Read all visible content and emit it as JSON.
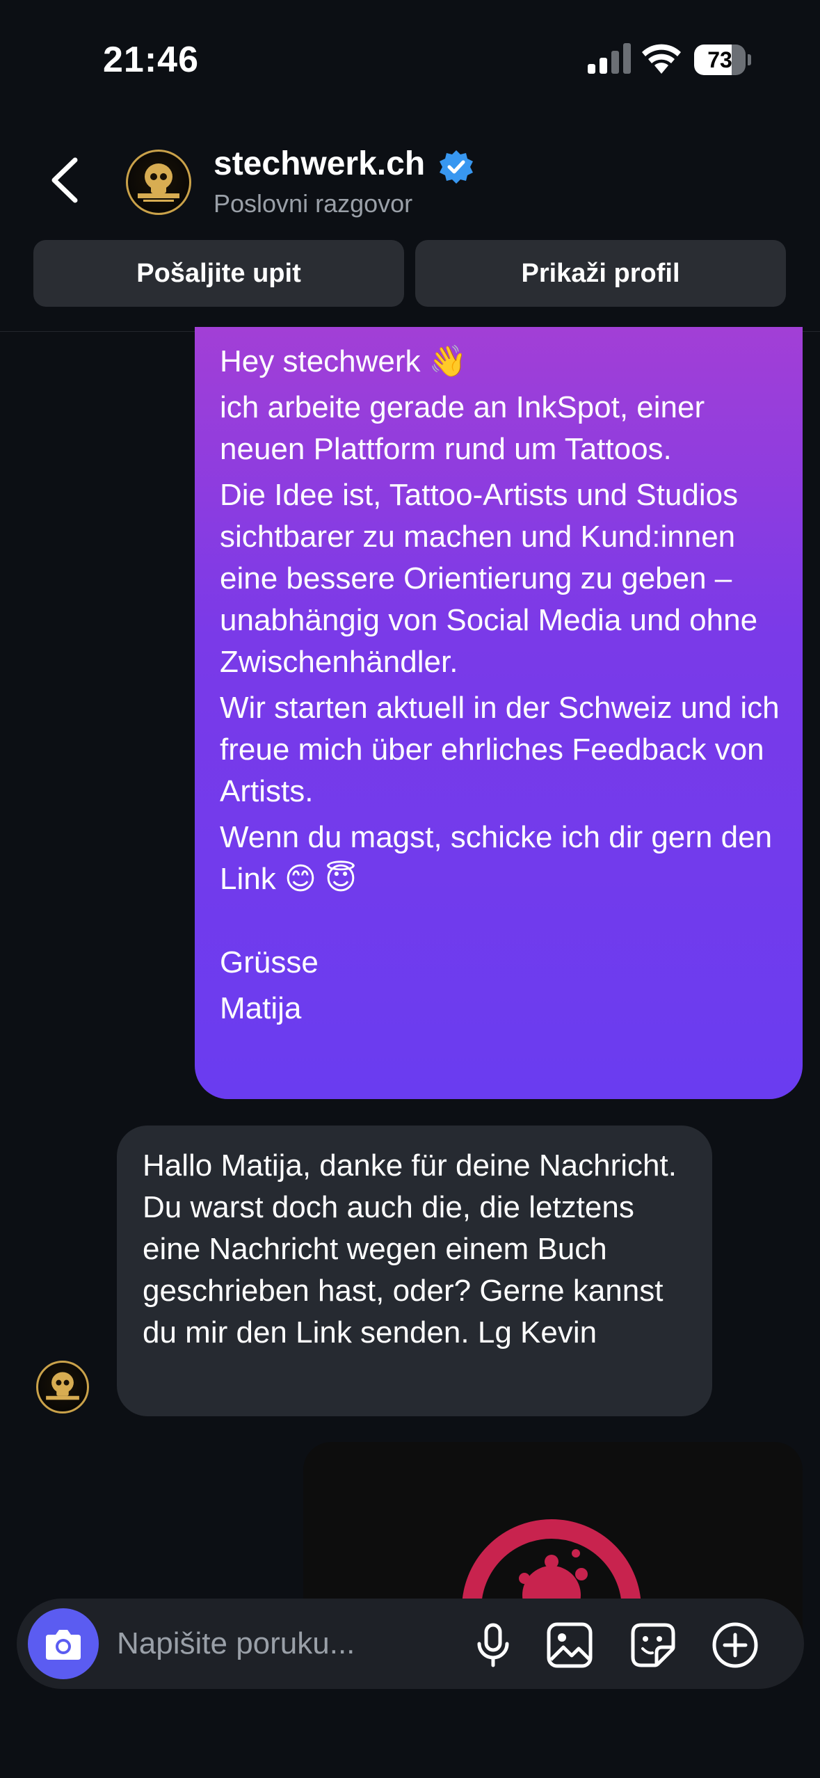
{
  "status_bar": {
    "time": "21:46",
    "battery": "73",
    "battery_level": 0.73
  },
  "header": {
    "name": "stechwerk.ch",
    "subtitle": "Poslovni razgovor",
    "actions": {
      "send_inquiry": "Pošaljite upit",
      "view_profile": "Prikaži profil"
    }
  },
  "messages": {
    "outgoing_1": {
      "paragraphs": [
        "Hey stechwerk 👋",
        "ich arbeite gerade an InkSpot, einer neuen Plattform rund um Tattoos.",
        "Die Idee ist, Tattoo-Artists und Studios sichtbarer zu machen und Kund:innen eine bessere Orientierung zu geben – unabhängig von Social Media und ohne Zwischenhändler.",
        "Wir starten aktuell in der Schweiz und ich freue mich über ehrliches Feedback von Artists.",
        "Wenn du magst, schicke ich dir gern den Link 😊 😇",
        "Grüsse",
        "Matija"
      ]
    },
    "incoming_1": {
      "text": "Hallo Matija, danke für deine Nachricht. Du warst doch auch die, die letztens eine Nachricht wegen einem Buch geschrieben hast, oder? Gerne kannst du mir den Link senden. Lg Kevin"
    }
  },
  "composer": {
    "placeholder": "Napišite poruku..."
  },
  "colors": {
    "background": "#0c0f14",
    "outgoing_top": "#a23fd6",
    "outgoing_bottom": "#6a3cf0",
    "incoming": "#262a31",
    "camera": "#5b5cf1",
    "verified": "#3897f0",
    "inkspot_logo": "#c8234e"
  },
  "icons": [
    "back-chevron-icon",
    "verified-badge-icon",
    "camera-icon",
    "microphone-icon",
    "gallery-icon",
    "sticker-icon",
    "plus-icon"
  ]
}
